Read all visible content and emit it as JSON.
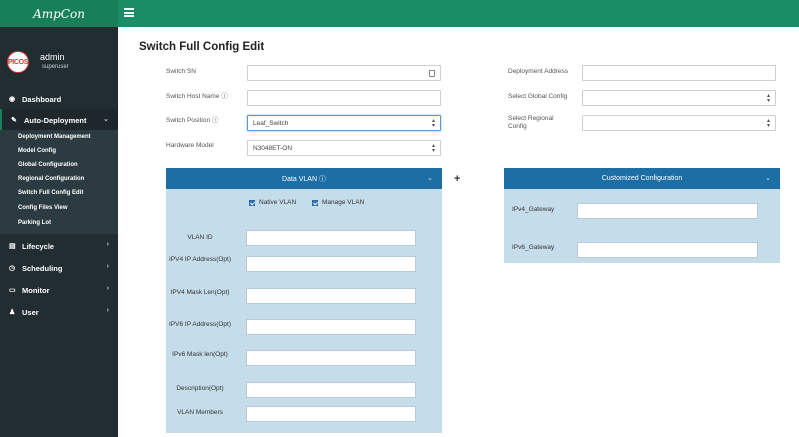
{
  "brand": {
    "logo_text": "AmpCon"
  },
  "user": {
    "avatar_text": "PICOS",
    "name": "admin",
    "role": "superuser"
  },
  "sidebar": {
    "dashboard": "Dashboard",
    "auto_deployment": "Auto-Deployment",
    "sub_items": [
      "Deployment Management",
      "Model Config",
      "Global Configuration",
      "Regional Configuration",
      "Switch Full Config Edit",
      "Config Files View",
      "Parking Lot"
    ],
    "lifecycle": "Lifecycle",
    "scheduling": "Scheduling",
    "monitor": "Monitor",
    "user": "User"
  },
  "page": {
    "title": "Switch Full Config Edit"
  },
  "form": {
    "switch_sn_label": "Switch SN",
    "switch_sn_value": "",
    "host_name_label": "Switch Host Name ⓘ",
    "host_name_value": "",
    "position_label": "Switch Position ⓘ",
    "position_value": "Leaf_Switch",
    "hardware_model_label": "Hardware Model",
    "hardware_model_value": "N3048ET-ON",
    "deployment_address_label": "Deployment Address",
    "deployment_address_value": "",
    "global_config_label": "Select Global Config",
    "global_config_value": "",
    "regional_config_label": "Select Regional Config",
    "regional_config_value": ""
  },
  "data_vlan": {
    "title": "Data VLAN ⓘ",
    "native_vlan": "Native VLAN",
    "manage_vlan": "Manage VLAN",
    "fields": [
      "VLAN ID",
      "IPV4 IP Address(Opt)",
      "IPV4 Mask Len(Opt)",
      "IPV6 IP Address(Opt)",
      "IPv6 Mask len(Opt)",
      "Description(Opt)",
      "VLAN Members"
    ]
  },
  "custom_config": {
    "title": "Customized Configuration",
    "ipv4_gateway_label": "IPv4_Gateway",
    "ipv6_gateway_label": "IPv6_Gateway"
  },
  "colors": {
    "topbar": "#1a8d67",
    "sidebar": "#222d32",
    "panel_header": "#1c6ea4",
    "panel_body": "#c5dcea"
  }
}
